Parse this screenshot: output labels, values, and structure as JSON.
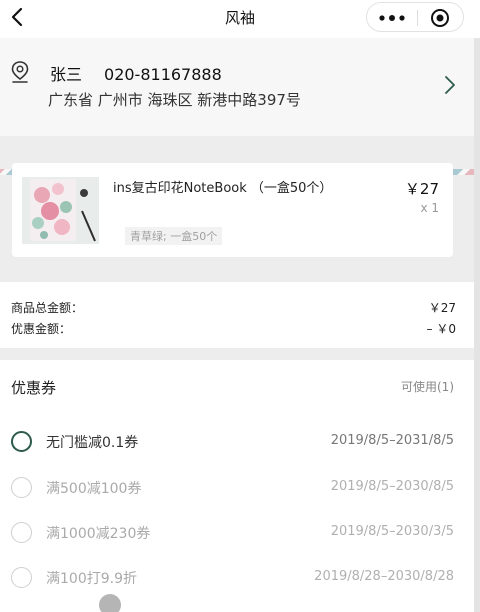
{
  "nav": {
    "title": "风袖"
  },
  "address": {
    "name": "张三",
    "phone": "020-81167888",
    "full": "广东省 广州市 海珠区 新港中路397号"
  },
  "product": {
    "name": "ins复古印花NoteBook （一盒50个）",
    "price": "￥27",
    "quantity": "x 1",
    "sku": "青草绿; 一盒50个"
  },
  "totals": {
    "goods_label": "商品总金额：",
    "goods_value": "￥27",
    "discount_label": "优惠金额：",
    "discount_value": "– ￥0"
  },
  "coupons": {
    "title": "优惠券",
    "available": "可使用(1)",
    "items": [
      {
        "name": "无门槛减0.1券",
        "dates": "2019/8/5–2031/8/5",
        "enabled": true
      },
      {
        "name": "满500减100券",
        "dates": "2019/8/5–2030/8/5",
        "enabled": false
      },
      {
        "name": "满1000减230券",
        "dates": "2019/8/5–2030/3/5",
        "enabled": false
      },
      {
        "name": "满100打9.9折",
        "dates": "2019/8/28–2030/8/28",
        "enabled": false
      }
    ]
  },
  "colors": {
    "accent": "#2d5a4a",
    "background": "#ededed",
    "airmail_red": "#e6b7bc",
    "airmail_blue": "#a9c9d3"
  },
  "icons": [
    "back-arrow-icon",
    "more-dots-icon",
    "target-circle-icon",
    "location-pin-icon",
    "chevron-right-icon"
  ]
}
